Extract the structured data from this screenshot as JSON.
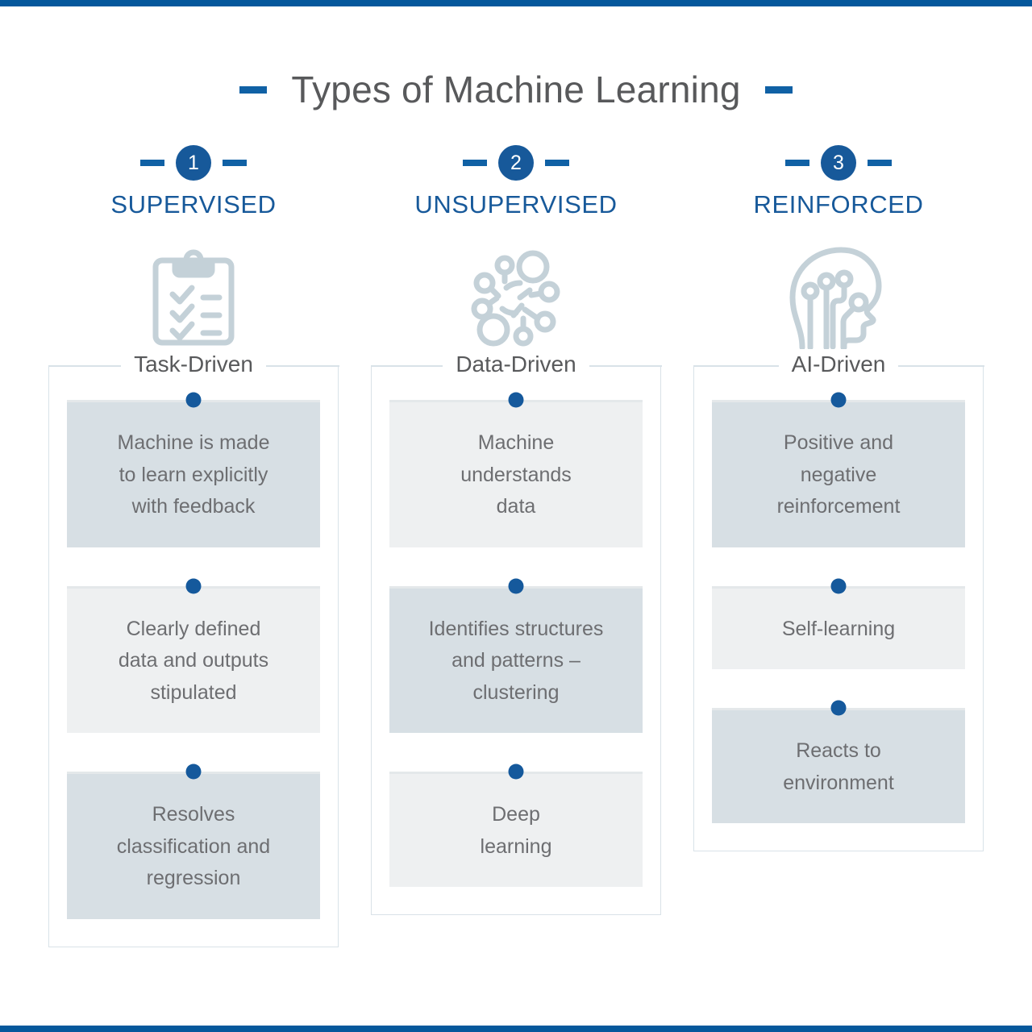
{
  "theme": {
    "accent_blue": "#05589c",
    "badge_blue": "#17599a",
    "dot_blue": "#15599c",
    "heading_gray": "#58595b",
    "body_gray": "#6d6e71",
    "shade_dark": "#d7dfe4",
    "shade_light": "#eef0f1",
    "icon_gray": "#c4d1d8",
    "border_gray": "#d9e2e8"
  },
  "header": {
    "title": "Types of Machine Learning"
  },
  "columns": [
    {
      "number": "1",
      "heading": "SUPERVISED",
      "icon": "clipboard-checklist-icon",
      "legend": "Task-Driven",
      "facts": [
        {
          "shade": "dark",
          "lines": [
            "Machine is made",
            "to learn explicitly",
            "with feedback"
          ]
        },
        {
          "shade": "light",
          "lines": [
            "Clearly defined",
            "data and outputs",
            "stipulated"
          ]
        },
        {
          "shade": "dark",
          "lines": [
            "Resolves",
            "classification and",
            "regression"
          ]
        }
      ]
    },
    {
      "number": "2",
      "heading": "UNSUPERVISED",
      "icon": "node-cluster-icon",
      "legend": "Data-Driven",
      "facts": [
        {
          "shade": "light",
          "lines": [
            "Machine",
            "understands",
            "data"
          ]
        },
        {
          "shade": "dark",
          "lines": [
            "Identifies structures",
            "and patterns –",
            "clustering"
          ]
        },
        {
          "shade": "light",
          "lines": [
            "Deep",
            "learning"
          ]
        }
      ]
    },
    {
      "number": "3",
      "heading": "REINFORCED",
      "icon": "head-circuit-icon",
      "legend": "AI-Driven",
      "facts": [
        {
          "shade": "dark",
          "lines": [
            "Positive and",
            "negative",
            "reinforcement"
          ]
        },
        {
          "shade": "light",
          "lines": [
            "Self-learning"
          ]
        },
        {
          "shade": "dark",
          "lines": [
            "Reacts to",
            "environment"
          ]
        }
      ]
    }
  ]
}
